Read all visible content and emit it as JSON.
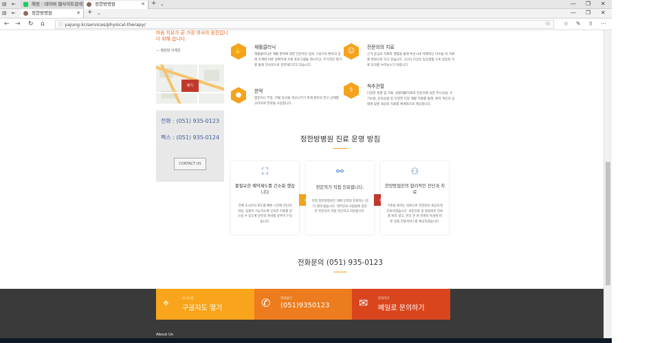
{
  "browser": {
    "tabs_row1": [
      {
        "label": "해링 : 네이버 웹사이트검색"
      },
      {
        "label": "정한방병원"
      }
    ],
    "tabs_row2": [
      {
        "label": "정한방병원"
      }
    ],
    "url": "yajung.kr/services/physical-therapy/"
  },
  "sidebar": {
    "slogan_lines": [
      "마음 치유가 곧 가장 의사의 원진입니",
      "다 위해 씁니다."
    ],
    "signature": "— 병원장 이재준",
    "map_badge": "찾기",
    "phone_label": "전화 :",
    "phone_value": "(051) 935-0123",
    "fax_label": "팩스 :",
    "fax_value": "(051) 935-0124",
    "contact_button": "CONTACT US"
  },
  "services": [
    {
      "icon": "hand-icon",
      "title": "재활클리닉",
      "desc": "재활클리닉은 재활 환자에 대한 전문적인 팀의 구성으로 환자의 장애 단계에 따른 정확하게 치료 프로그램을 제시하고, 주기적인 평가를 통해 지속적으로 관리해드리고 있습니다."
    },
    {
      "icon": "people-icon",
      "title": "전문의의 치료",
      "desc": "근거 중심의 치료와 경험을 통해 투산시내 체계적인 비수술 적 치료를 병원으로 하고 있습니다. 3인의 이상의 임상경험 으로 입증된 치료 효과를 누려보시기 바랍니다."
    },
    {
      "icon": "pill-icon",
      "title": "한약",
      "desc": "염증이나 부종, 저혈 증상을 개선시키기 위해 환자의 전신 상태를 고려하여 한약을 사용합니다."
    },
    {
      "icon": "needle-icon",
      "title": "척추관절",
      "desc": "다양한 첫결 힘 치료, 방향재활치료과 전문의에 의한 추나요법, 수기요법, 운동요법 등 다양한 전문 재활 치료를 통해, 환자 개인의 상태에 맞춘 최상의 치료를 체계적으로 제공합니다."
    }
  ],
  "policy_title": "정한방병원 진료 운영 방침",
  "cards": [
    {
      "icon": "bed-icon",
      "title": "불필요한 예약제도를 간소화 했습니다",
      "desc": "전체 도시안의 외도를 빠른 시간에 진단과 처방, 입원이 가능하도록 신속한 치료를 받으실 수 있도록 만전의 준비를 갖추어 두었습니다."
    },
    {
      "icon": "dna-icon",
      "title": "전문의가 직접 진료합니다.",
      "desc": "저희 정한방병원은 대체 인력의 진료하는 일이 절대 없습니다. 대부분의 사람들에 충분한 전문의가 직접 진단하고 처방합니다."
    },
    {
      "icon": "doctors-icon",
      "title": "한양방협진의 합리적인 진단과 치료",
      "desc": "기존을 원하는 의료으로 한양방이 세심하게 진료하겠습니다. 과잉진료 및 영업위된 진료를 바라 않고, 한각 한 명 한명의 특성에 따른 맞춤 진료서비스를 제공하겠습니다."
    }
  ],
  "tel_line": "전화문의 (051) 935-0123",
  "footer": {
    "boxes": [
      {
        "icon": "map-icon",
        "small": "오시는길",
        "main": "구글지도 열기",
        "color": "#f9a51b"
      },
      {
        "icon": "phone-icon",
        "small": "전화걸기",
        "main": "(051)9350123",
        "color": "#ec7c1e"
      },
      {
        "icon": "mail-icon",
        "small": "문의하기",
        "main": "메일로 문의하기",
        "color": "#d9461e"
      }
    ],
    "about": "About Us"
  },
  "colors": {
    "accent": "#f6a21d",
    "dark_orange": "#e8631c",
    "brick": "#c0392b",
    "footer_bg": "#3a3a3a"
  }
}
